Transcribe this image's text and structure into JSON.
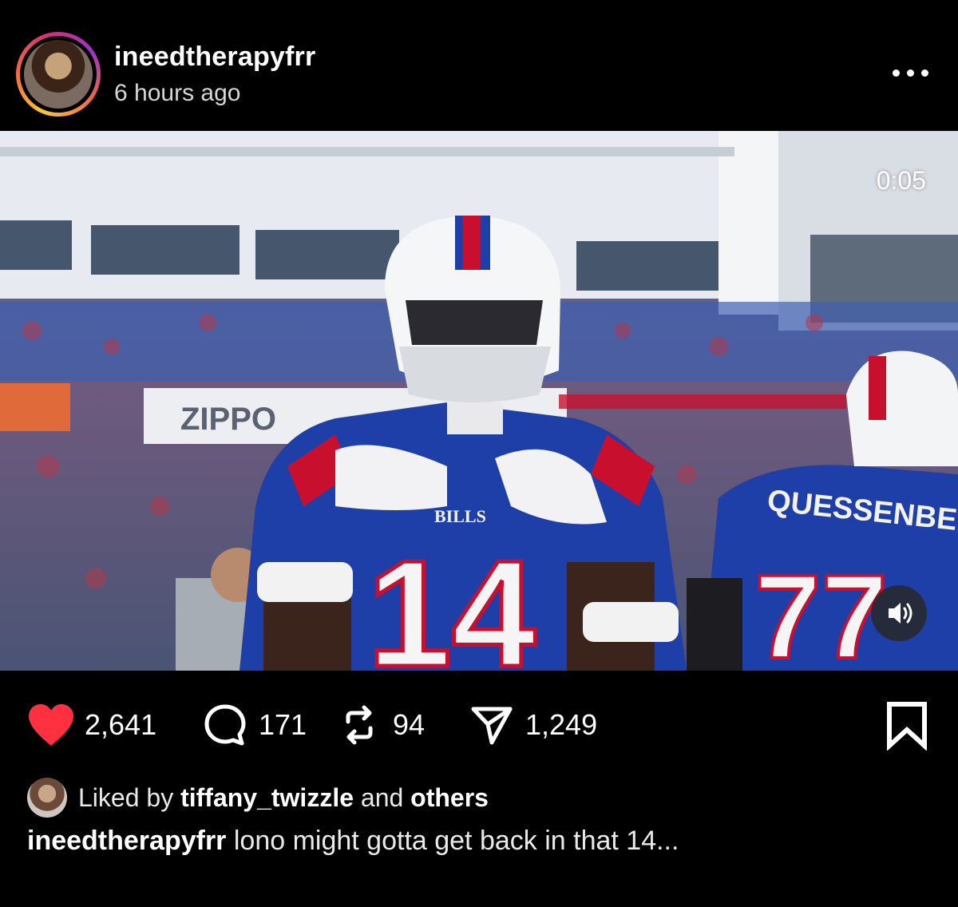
{
  "post": {
    "username": "ineedtherapyfrr",
    "time_ago": "6 hours ago"
  },
  "media": {
    "duration": "0:05",
    "scene": {
      "banner_text": "ZIPPO",
      "jersey_brand": "BILLS",
      "jersey_number_main": "14",
      "player2_name": "QUESSENBERRY",
      "player2_number": "77"
    }
  },
  "actions": {
    "likes": "2,641",
    "comments": "171",
    "reposts": "94",
    "shares": "1,249"
  },
  "liked_by": {
    "prefix": "Liked by",
    "user": "tiffany_twizzle",
    "connector": "and",
    "others": "others"
  },
  "caption": {
    "username": "ineedtherapyfrr",
    "text": "lono might gotta get back in that 14..."
  },
  "colors": {
    "like_red": "#ff3040",
    "bills_blue": "#1f3fa8",
    "bills_red": "#c8102e"
  }
}
